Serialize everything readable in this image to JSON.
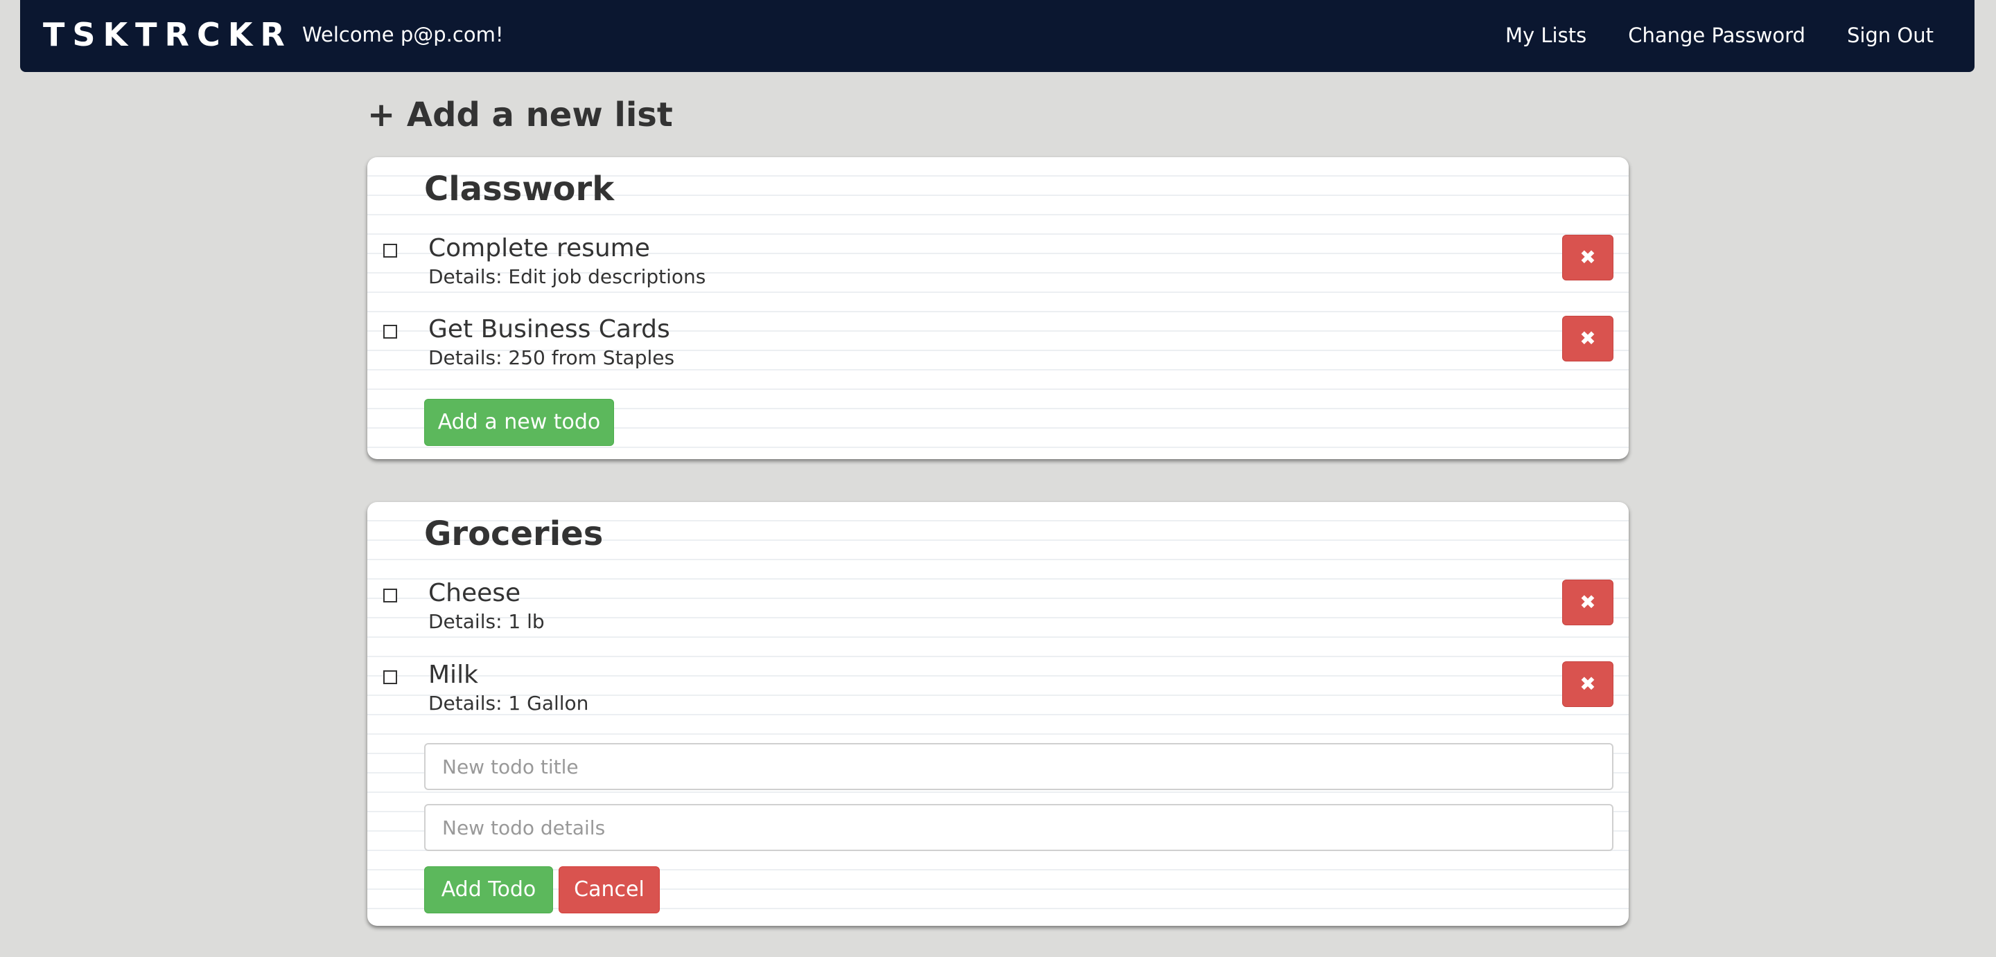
{
  "navbar": {
    "brand": "TSKTRCKR",
    "welcome": "Welcome p@p.com!",
    "links": [
      "My Lists",
      "Change Password",
      "Sign Out"
    ]
  },
  "add_list_label": "+ Add a new list",
  "lists": [
    {
      "title": "Classwork",
      "todos": [
        {
          "title": "Complete resume",
          "details": "Details: Edit job descriptions",
          "done": false
        },
        {
          "title": "Get Business Cards",
          "details": "Details: 250 from Staples",
          "done": false
        }
      ],
      "add_todo_label": "Add a new todo"
    },
    {
      "title": "Groceries",
      "todos": [
        {
          "title": "Cheese",
          "details": "Details: 1 lb",
          "done": false
        },
        {
          "title": "Milk",
          "details": "Details: 1 Gallon",
          "done": false
        }
      ],
      "form": {
        "title_placeholder": "New todo title",
        "details_placeholder": "New todo details",
        "submit_label": "Add Todo",
        "cancel_label": "Cancel"
      }
    }
  ],
  "icons": {
    "delete": "close-icon",
    "checkbox": "checkbox-unchecked-icon",
    "delete_glyph": "✖"
  },
  "colors": {
    "navbar": "#0b1730",
    "background": "#dcdcda",
    "success": "#5cb85c",
    "danger": "#d9534f"
  }
}
